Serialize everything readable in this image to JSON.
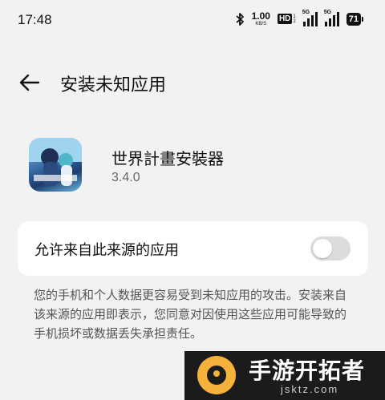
{
  "status_bar": {
    "time": "17:48",
    "net_speed_value": "1.00",
    "net_speed_unit": "KB/S",
    "hd_label": "HD",
    "hd_sim1": "1",
    "hd_sim2": "2",
    "sim1_tag": "5G",
    "sim2_tag": "5G",
    "battery": "71",
    "icons": [
      "bluetooth-icon",
      "signal-icon",
      "battery-icon"
    ]
  },
  "header": {
    "title": "安装未知应用",
    "back_icon": "arrow-left-icon"
  },
  "app": {
    "name": "世界計畫安裝器",
    "version": "3.4.0"
  },
  "setting": {
    "label": "允许来自此来源的应用",
    "enabled": false
  },
  "description": "您的手机和个人数据更容易受到未知应用的攻击。安装来自该来源的应用即表示，您同意对因使用这些应用可能导致的手机损坏或数据丢失承担责任。",
  "watermark": {
    "title": "手游开拓者",
    "url": "jsktz.com"
  },
  "colors": {
    "background": "#f2f2f2",
    "card": "#ffffff",
    "toggle_off": "#dcdcdc",
    "watermark_bg": "#1b1b1b",
    "watermark_accent": "#f4b23a"
  }
}
